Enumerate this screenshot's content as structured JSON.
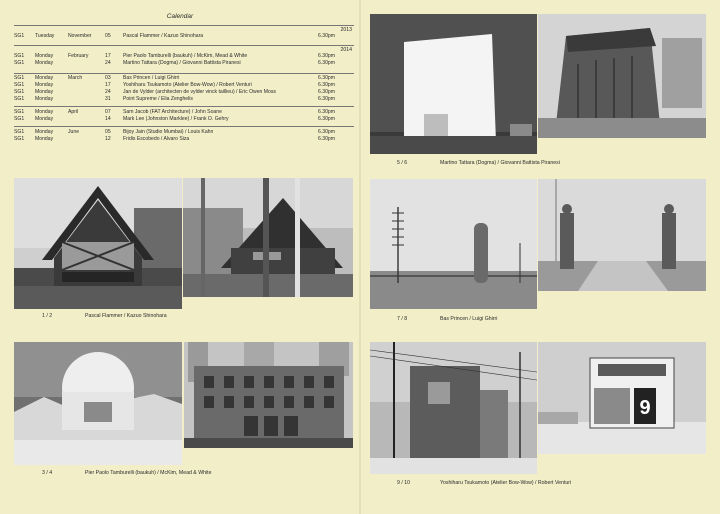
{
  "calendar": {
    "title": "Calendar",
    "years": [
      "2013",
      "2014"
    ],
    "rows": [
      {
        "code": "SG1",
        "day": "Tuesday",
        "month": "November",
        "date": "05",
        "title": "Pascal Flammer / Kazuo Shinohara",
        "time": "6.30pm"
      },
      {
        "code": "SG1",
        "day": "Monday",
        "month": "February",
        "date": "17",
        "title": "Pier Paolo Tamburelli (baukuh) / McKim, Mead & White",
        "time": "6.30pm"
      },
      {
        "code": "SG1",
        "day": "Monday",
        "month": "",
        "date": "24",
        "title": "Martino Tattara (Dogma) / Giovanni Battista Piranesi",
        "time": "6.30pm"
      },
      {
        "code": "SG1",
        "day": "Monday",
        "month": "March",
        "date": "03",
        "title": "Bas Princen / Luigi Ghirri",
        "time": "6.30pm"
      },
      {
        "code": "SG1",
        "day": "Monday",
        "month": "",
        "date": "17",
        "title": "Yoshiharu Tsukamoto (Atelier Bow-Wow) / Robert Venturi",
        "time": "6.30pm"
      },
      {
        "code": "SG1",
        "day": "Monday",
        "month": "",
        "date": "24",
        "title": "Jan de Vylder (architecten de vylder vinck taillieu) / Eric Owen Moss",
        "time": "6.30pm"
      },
      {
        "code": "SG1",
        "day": "Monday",
        "month": "",
        "date": "31",
        "title": "Point Supreme / Elia Zenghelis",
        "time": "6.30pm"
      },
      {
        "code": "SG1",
        "day": "Monday",
        "month": "April",
        "date": "07",
        "title": "Sam Jacob (FAT Architecture) / John Soane",
        "time": "6.30pm"
      },
      {
        "code": "SG1",
        "day": "Monday",
        "month": "",
        "date": "14",
        "title": "Mark Lee (Johnston Marklee) / Frank O. Gehry",
        "time": "6.30pm"
      },
      {
        "code": "SG1",
        "day": "Monday",
        "month": "June",
        "date": "05",
        "title": "Bijoy Jain (Studio Mumbai) / Louis Kahn",
        "time": "6.30pm"
      },
      {
        "code": "SG1",
        "day": "Monday",
        "month": "",
        "date": "12",
        "title": "Fridis Escobedo / Alvaro Siza",
        "time": "6.30pm"
      }
    ]
  },
  "captions": {
    "c12": {
      "num": "1 / 2",
      "text": "Pascal Flammer / Kazuo Shinohara"
    },
    "c34": {
      "num": "3 / 4",
      "text": "Pier Paolo Tamburelli (baukuh) / McKim, Mead & White"
    },
    "c56": {
      "num": "5 / 6",
      "text": "Martino Tattara (Dogma) / Giovanni Battista Piranesi"
    },
    "c78": {
      "num": "7 / 8",
      "text": "Bas Princen / Luigi Ghirri"
    },
    "c910": {
      "num": "9 / 10",
      "text": "Yoshiharu Tsukamoto (Atelier Bow-Wow) / Robert Venturi"
    }
  },
  "photos": {
    "p9_number": "9"
  }
}
